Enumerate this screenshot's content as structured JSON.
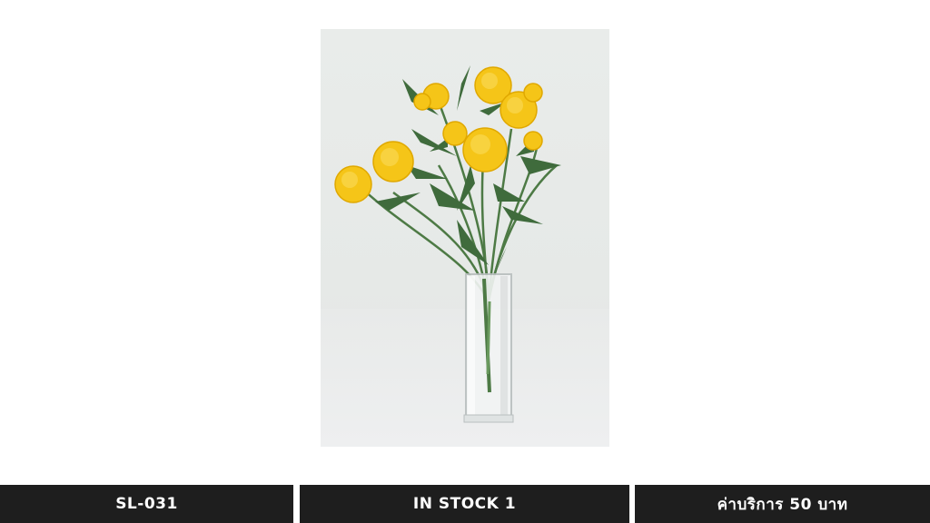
{
  "product": {
    "image_icon": "marigold-bouquet-in-glass-vase",
    "code": "SL-031",
    "stock": "IN STOCK 1",
    "price": "ค่าบริการ 50 บาท"
  },
  "colors": {
    "bar_bg": "#1e1e1e",
    "bar_text": "#ffffff",
    "flower": "#f5c518",
    "leaf": "#3f6b3c"
  }
}
